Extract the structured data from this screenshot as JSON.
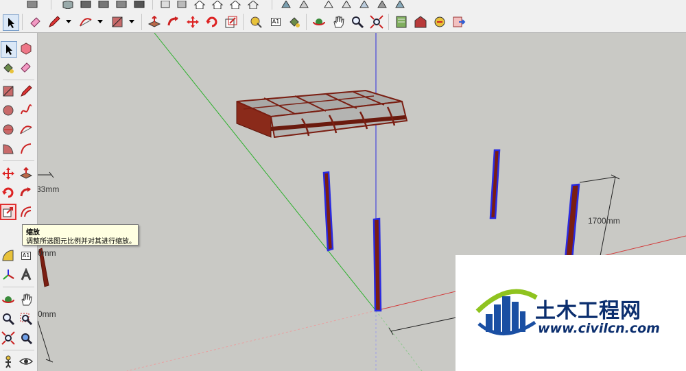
{
  "tooltip": {
    "title": "缩放",
    "description": "调整所选图元比例并对其进行缩放。"
  },
  "dimensions": {
    "d1": "1700mm",
    "d2": "33mm",
    "d3": "0mm",
    "d4": "0mm"
  },
  "watermark": {
    "name": "土木工程网",
    "url": "www.civilcn.com"
  },
  "toolbar": {
    "text_tool_label": "A1"
  },
  "colors": {
    "toolbar_bg": "#f0f0f0",
    "viewport_bg": "#c9c9c5",
    "red_axis": "#d23a3a",
    "green_axis": "#2bb02b",
    "blue_axis": "#2a2ae0",
    "highlight": "#e03030",
    "wood": "#7a1e12"
  }
}
